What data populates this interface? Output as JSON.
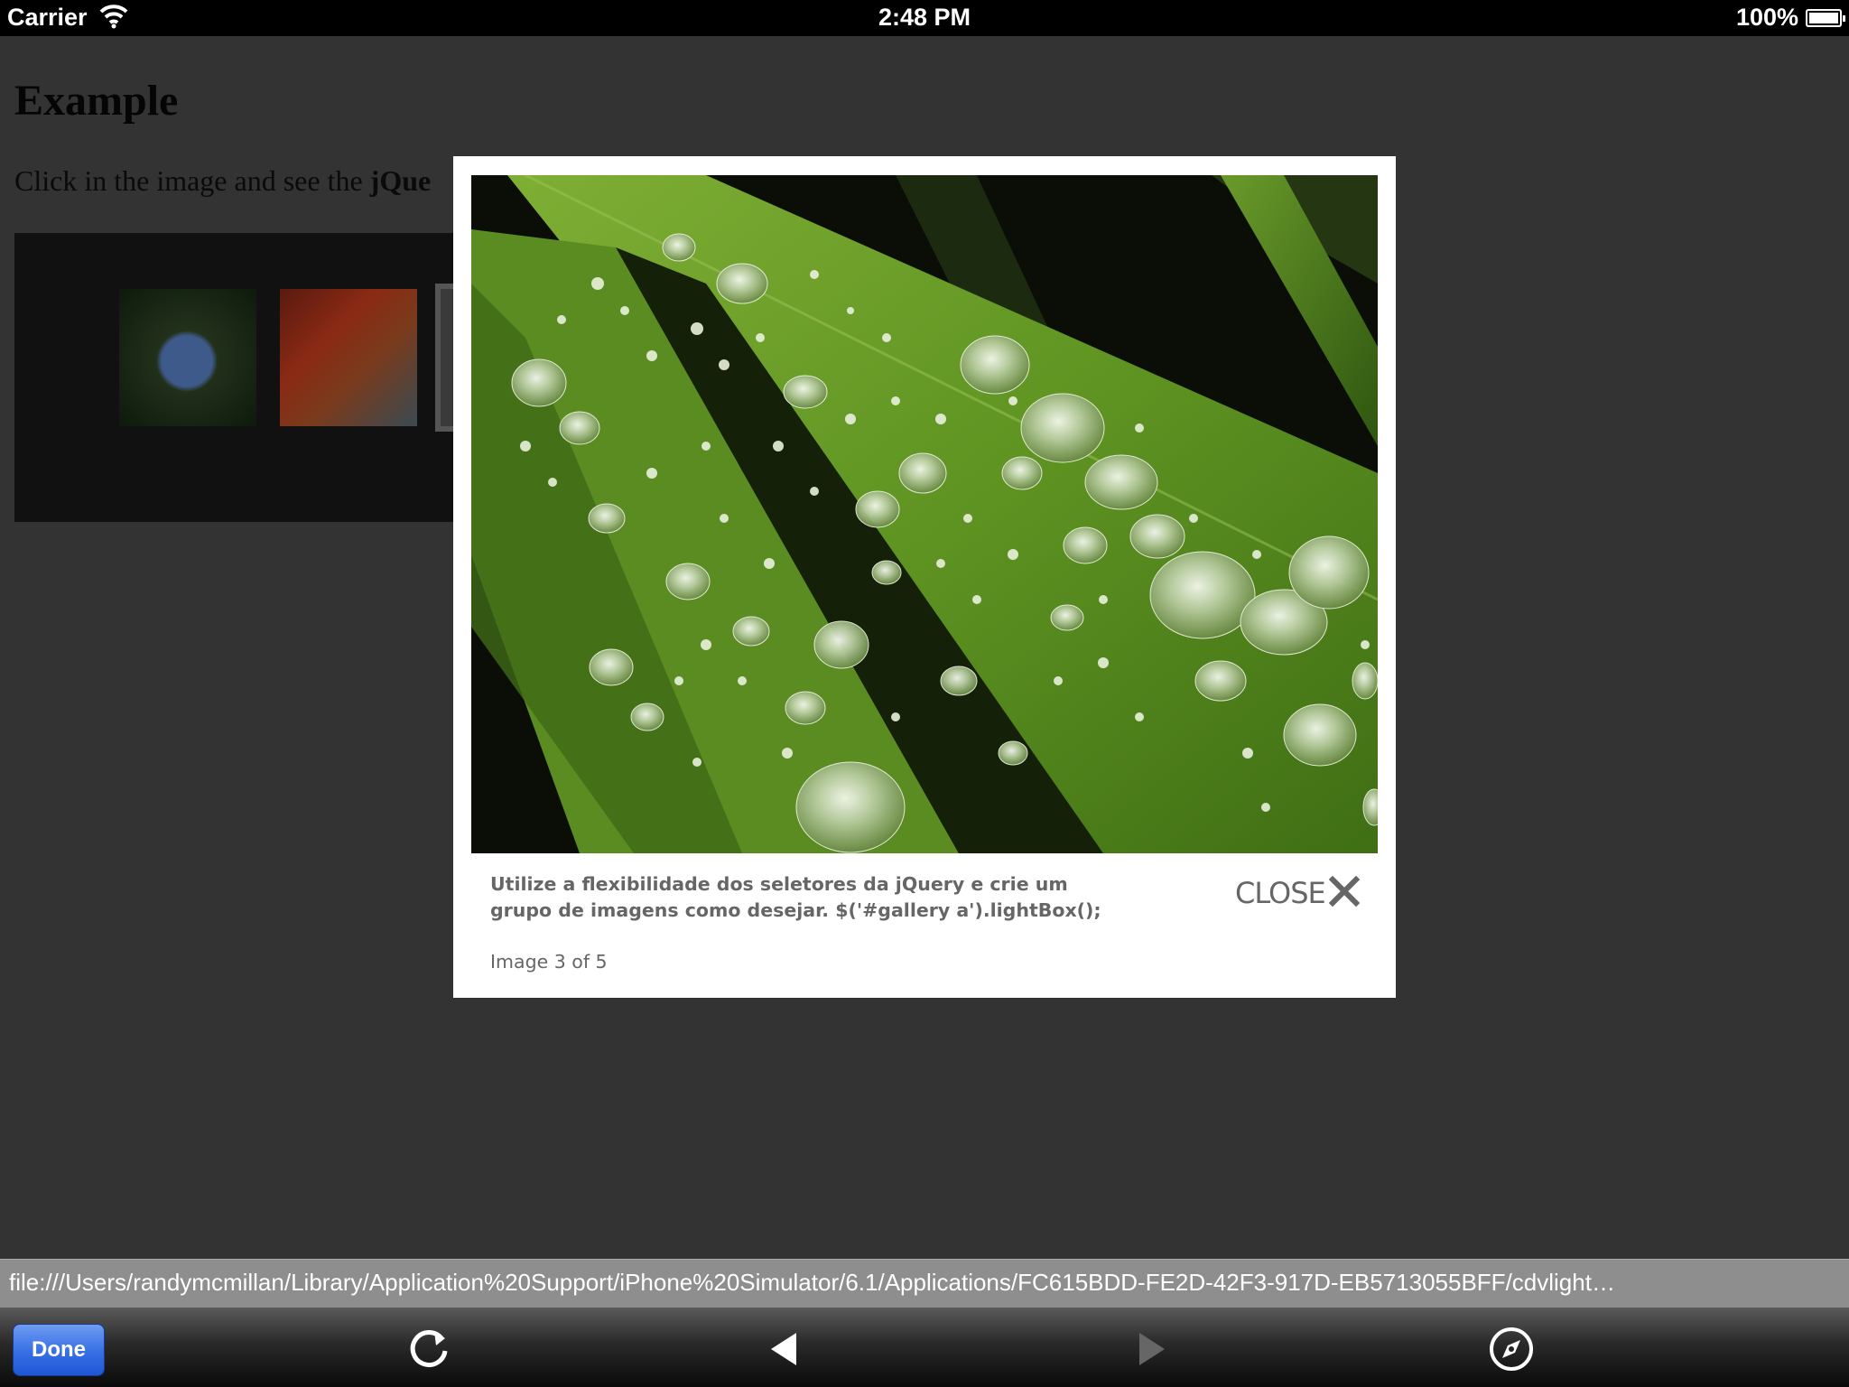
{
  "status_bar": {
    "carrier": "Carrier",
    "time": "2:48 PM",
    "battery": "100%"
  },
  "page": {
    "heading": "Example",
    "intro_prefix": "Click in the image and see the ",
    "intro_bold": "jQue"
  },
  "lightbox": {
    "caption": "Utilize a flexibilidade dos seletores da jQuery e crie um grupo de imagens como desejar. $('#gallery a').lightBox();",
    "image_number": "Image 3 of 5",
    "close_label": "CLOSE"
  },
  "url_bar": {
    "url": "file:///Users/randymcmillan/Library/Application%20Support/iPhone%20Simulator/6.1/Applications/FC615BDD-FE2D-42F3-917D-EB5713055BFF/cdvlight…"
  },
  "toolbar": {
    "done_label": "Done",
    "icons": [
      "refresh-icon",
      "back-icon",
      "forward-icon",
      "safari-compass-icon"
    ]
  },
  "colors": {
    "overlay": "#333333",
    "done_button": "#2f66de",
    "caption_text": "#666666"
  }
}
